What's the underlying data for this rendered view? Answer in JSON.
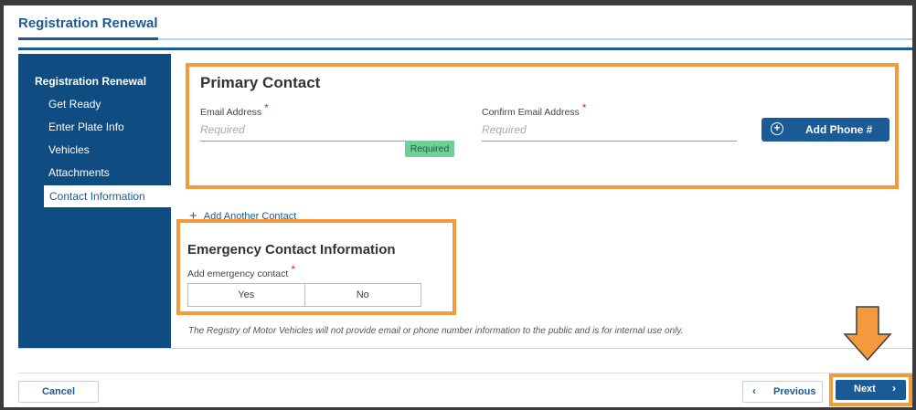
{
  "page": {
    "title": "Registration Renewal"
  },
  "sidebar": {
    "heading": "Registration Renewal",
    "items": [
      {
        "label": "Get Ready"
      },
      {
        "label": "Enter Plate Info"
      },
      {
        "label": "Vehicles"
      },
      {
        "label": "Attachments"
      },
      {
        "label": "Contact Information"
      }
    ]
  },
  "primary_contact": {
    "title": "Primary Contact",
    "email_label": "Email Address",
    "email_placeholder": "Required",
    "confirm_label": "Confirm Email Address",
    "confirm_placeholder": "Required",
    "required_badge": "Required",
    "add_phone_label": "Add Phone #"
  },
  "add_another_contact": "Add Another Contact",
  "emergency": {
    "title": "Emergency Contact Information",
    "question": "Add emergency contact",
    "yes": "Yes",
    "no": "No"
  },
  "disclaimer": "The Registry of Motor Vehicles will not provide email or phone number information to the public and is for internal use only.",
  "footer": {
    "cancel": "Cancel",
    "previous": "Previous",
    "next": "Next"
  },
  "colors": {
    "brand": "#1a5a96",
    "sidebar": "#0f4c81",
    "highlight": "#f39a3c",
    "required_badge": "#6fcf97",
    "required_star": "#d9262e"
  }
}
